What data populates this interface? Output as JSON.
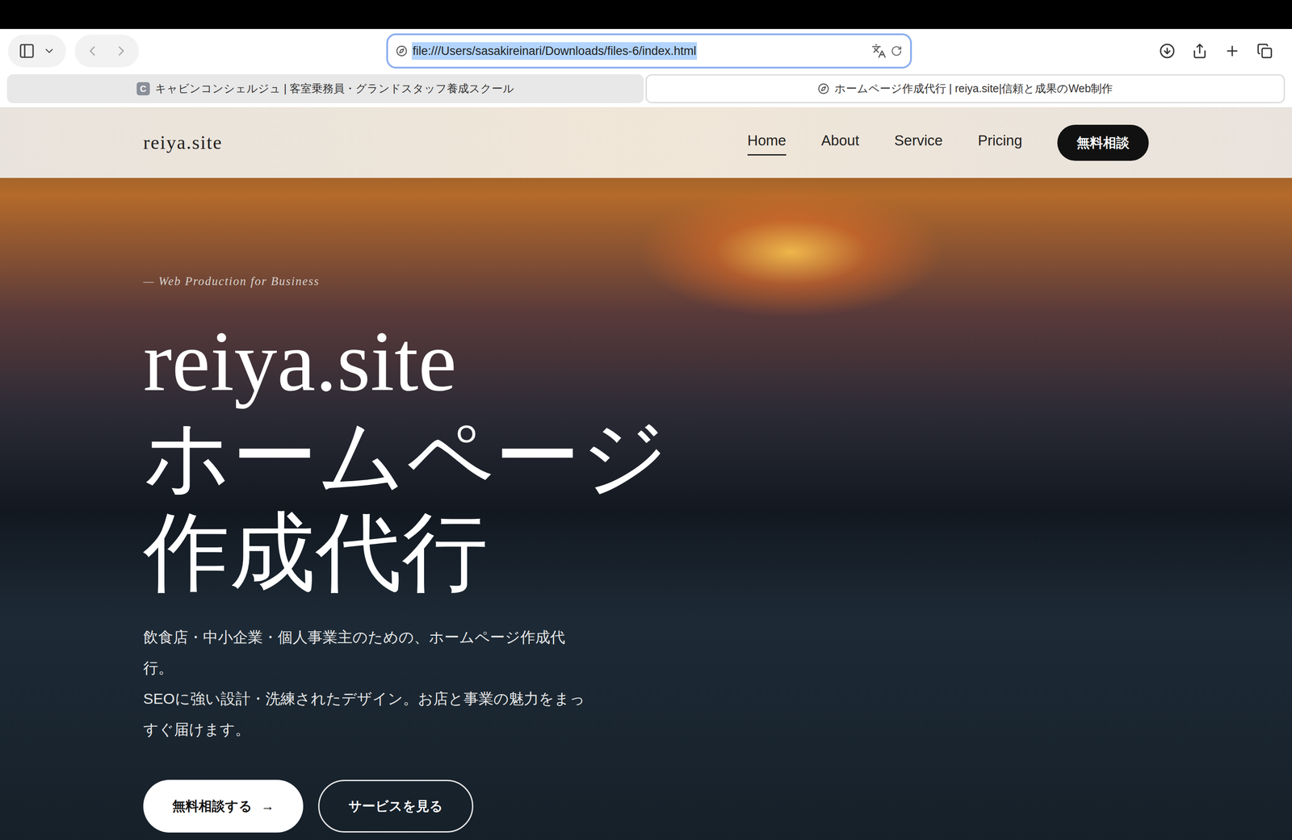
{
  "browser": {
    "url": "file:///Users/sasakireinari/Downloads/files-6/index.html",
    "url_selected": true,
    "tabs": [
      {
        "label": "キャビンコンシェルジュ | 客室乗務員・グランドスタッフ養成スクール",
        "favicon": "C",
        "selected": false
      },
      {
        "label": "ホームページ作成代行 | reiya.site|信頼と成果のWeb制作",
        "favicon": "",
        "selected": true
      }
    ]
  },
  "site": {
    "logo": "reiya.site",
    "nav": [
      {
        "label": "Home",
        "selected": true
      },
      {
        "label": "About",
        "selected": false
      },
      {
        "label": "Service",
        "selected": false
      },
      {
        "label": "Pricing",
        "selected": false
      }
    ],
    "cta": "無料相談"
  },
  "hero": {
    "tagline": "— Web Production for Business",
    "title": [
      "reiya.site",
      "ホームページ",
      "作成代行"
    ],
    "description": [
      "飲食店・中小企業・個人事業主のための、ホームページ作成代行。",
      "SEOに強い設計・洗練されたデザイン。お店と事業の魅力をまっすぐ届けます。"
    ],
    "buttons": [
      {
        "label": "無料相談する",
        "arrow": "→",
        "kind": "primary"
      },
      {
        "label": "サービスを見る",
        "arrow": "",
        "kind": "secondary"
      }
    ]
  }
}
